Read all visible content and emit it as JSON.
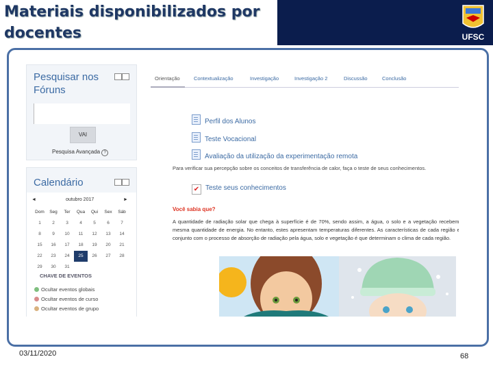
{
  "slide": {
    "title": "Materiais disponibilizados por docentes",
    "date": "03/11/2020",
    "page_number": "68",
    "logo_text": "UFSC"
  },
  "search_block": {
    "title": "Pesquisar nos Fóruns",
    "button": "VAI",
    "advanced_link": "Pesquisa Avançada"
  },
  "calendar": {
    "title": "Calendário",
    "month": "outubro 2017",
    "prev_label": "◄",
    "next_label": "►",
    "weekdays": [
      "Dom",
      "Seg",
      "Ter",
      "Qua",
      "Qui",
      "Sex",
      "Sáb"
    ],
    "weeks": [
      [
        "1",
        "2",
        "3",
        "4",
        "5",
        "6",
        "7"
      ],
      [
        "8",
        "9",
        "10",
        "11",
        "12",
        "13",
        "14"
      ],
      [
        "15",
        "16",
        "17",
        "18",
        "19",
        "20",
        "21"
      ],
      [
        "22",
        "23",
        "24",
        "25",
        "26",
        "27",
        "28"
      ],
      [
        "29",
        "30",
        "31",
        "",
        "",
        "",
        ""
      ]
    ],
    "today": "25",
    "events_title": "CHAVE DE EVENTOS",
    "events": [
      {
        "label": "Ocultar eventos globais",
        "color": "#7fbf7f"
      },
      {
        "label": "Ocultar eventos de curso",
        "color": "#d98c8c"
      },
      {
        "label": "Ocultar eventos de grupo",
        "color": "#d9b27f"
      }
    ]
  },
  "tabs": [
    "Orientação",
    "Contextualização",
    "Investigação",
    "Investigação 2",
    "Discussão",
    "Conclusão"
  ],
  "activities": [
    "Perfil dos Alunos",
    "Teste Vocacional",
    "Avaliação da utilização da experimentação remota"
  ],
  "intro_text": "Para verificar sua percepção sobre os conceitos de transferência de calor, faça o teste de seus conhecimentos.",
  "quiz_link": "Teste seus conhecimentos",
  "alert": {
    "title": "Você sabia que?",
    "text": "A quantidade de radiação solar que chega à superfície é de 70%, sendo assim, a água, o solo e a vegetação recebem a mesma quantidade de energia. No entanto, estes apresentam temperaturas diferentes. As características de cada região em conjunto com o processo de absorção de radiação pela água, solo e vegetação é que determinam o clima de cada região."
  },
  "colors": {
    "title": "#1f3864",
    "header_band": "#0b1d4d",
    "frame": "#4a6fa5",
    "link": "#3b6aa3",
    "alert": "#d32f2f"
  }
}
